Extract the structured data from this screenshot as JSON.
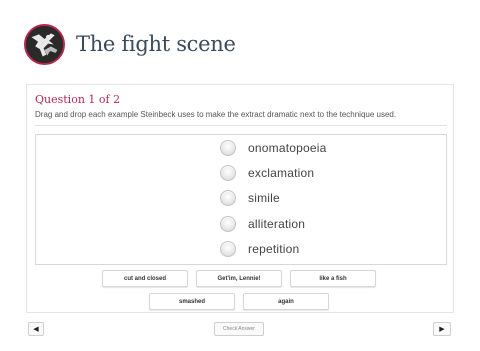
{
  "header": {
    "title": "The fight scene",
    "logo_icon": "fighters-silhouette-icon",
    "accent_color": "#b5294e"
  },
  "question": {
    "title": "Question 1 of 2",
    "instructions": "Drag and drop each example Steinbeck uses to make the extract dramatic next to the technique used."
  },
  "techniques": [
    {
      "label": "onomatopoeia",
      "icon": "drop-target-icon"
    },
    {
      "label": "exclamation",
      "icon": "drop-target-icon"
    },
    {
      "label": "simile",
      "icon": "drop-target-icon"
    },
    {
      "label": "alliteration",
      "icon": "drop-target-icon"
    },
    {
      "label": "repetition",
      "icon": "drop-target-icon"
    }
  ],
  "answer_chips": [
    {
      "label": "cut and closed"
    },
    {
      "label": "Get'im, Lennie!"
    },
    {
      "label": "like a fish"
    },
    {
      "label": "smashed"
    },
    {
      "label": "again"
    }
  ],
  "footer": {
    "prev_icon": "triangle-left-icon",
    "prev_symbol": "◀",
    "check_answer_label": "Check Answer",
    "next_icon": "triangle-right-icon",
    "next_symbol": "▶"
  }
}
